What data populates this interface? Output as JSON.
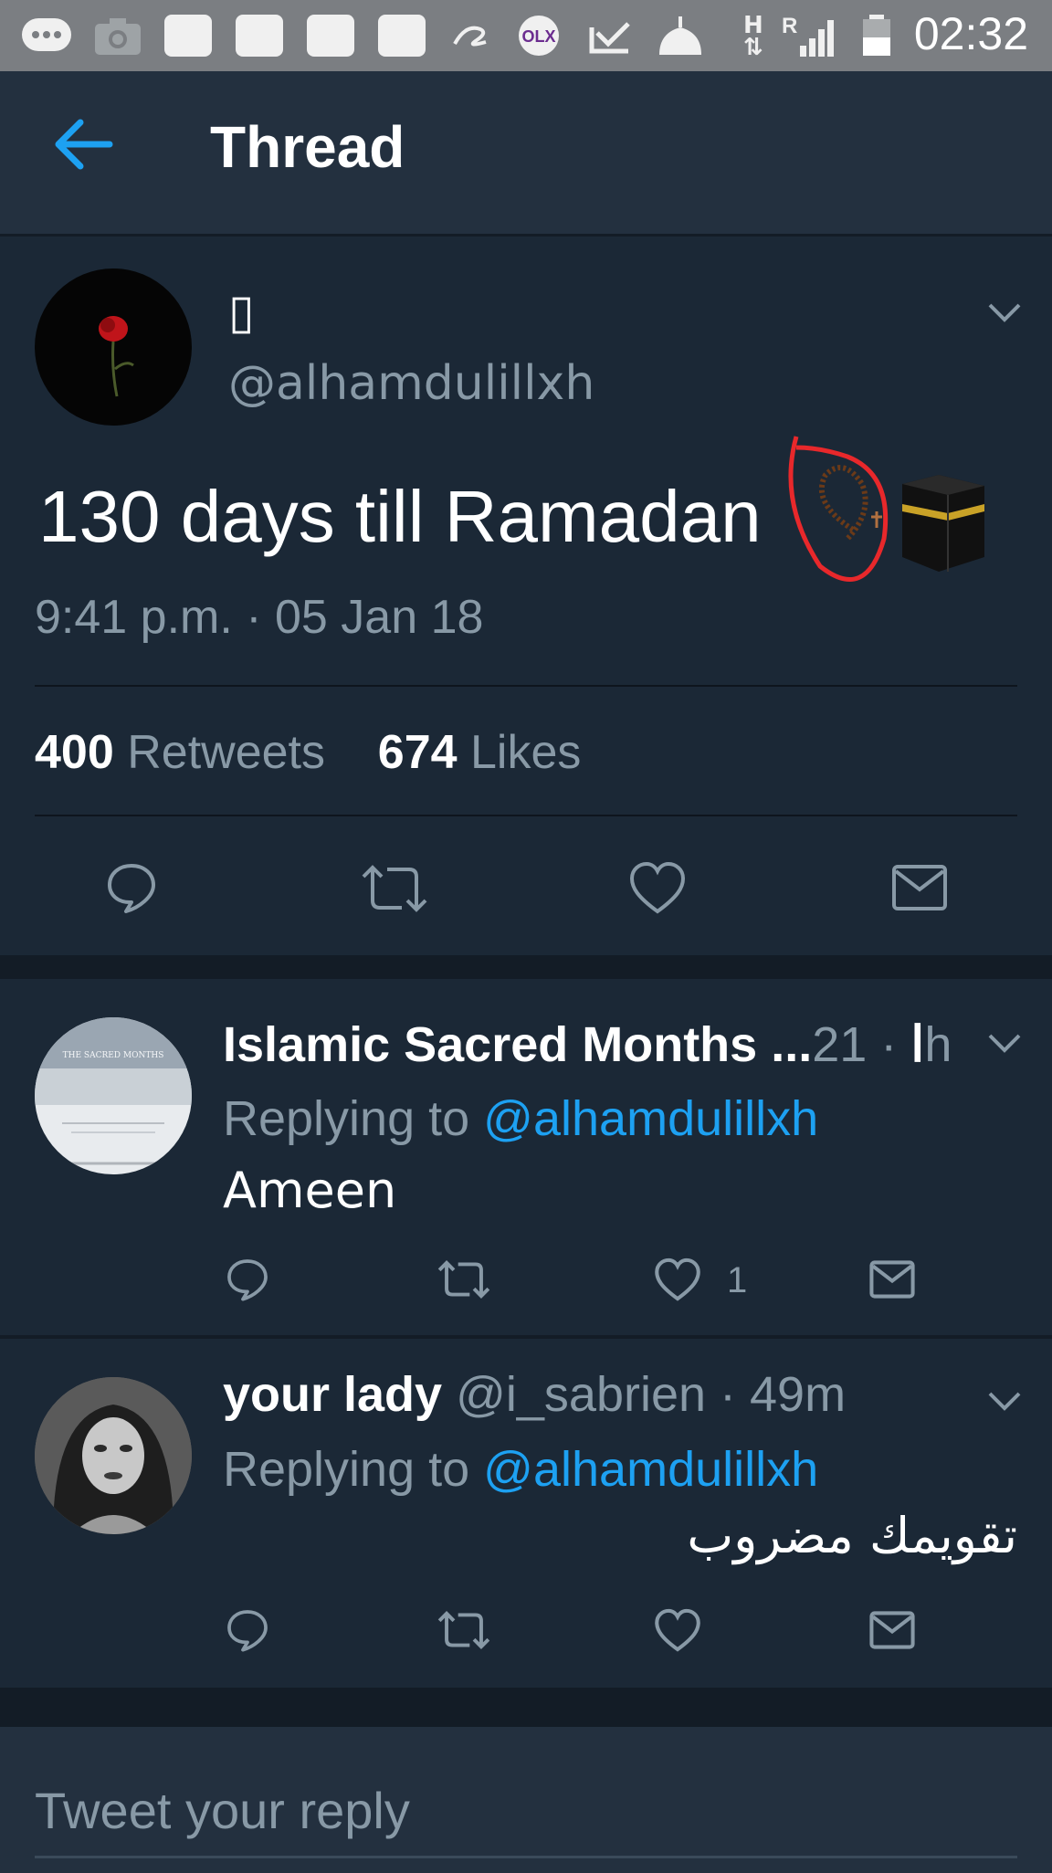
{
  "status_bar": {
    "time": "02:32",
    "network_labels": [
      "H",
      "R"
    ],
    "app_badge": "OLX",
    "icons": [
      "messages-icon",
      "camera-icon",
      "app-icon",
      "app-icon",
      "app-icon",
      "app-icon",
      "alibaba-icon",
      "olx-icon",
      "check-icon",
      "mosque-icon",
      "signal-icon",
      "battery-icon"
    ]
  },
  "app_bar": {
    "title": "Thread",
    "back_icon": "back-arrow-icon"
  },
  "main_tweet": {
    "display_name": "▯",
    "handle": "@alhamdulillxh",
    "text": "130 days till Ramadan",
    "emojis": [
      "prayer-beads-icon",
      "kaaba-icon"
    ],
    "timestamp": "9:41 p.m. · 05 Jan 18",
    "retweet_count": "400",
    "retweet_label": "Retweets",
    "like_count": "674",
    "like_label": "Likes"
  },
  "replies": [
    {
      "name": "Islamic Sacred Months ...ا",
      "meta": " · 21h",
      "replying_prefix": "Replying to ",
      "replying_to": "@alhamdulillxh",
      "text": "Ameen",
      "like_count": "1",
      "avatar_caption": "THE SACRED MONTHS"
    },
    {
      "name": "your lady",
      "meta": " @i_sabrien · 49m",
      "replying_prefix": "Replying to ",
      "replying_to": "@alhamdulillxh",
      "text": "تقويمك مضروب",
      "like_count": ""
    }
  ],
  "composer": {
    "placeholder": "Tweet your reply"
  },
  "colors": {
    "background": "#1b2836",
    "bar": "#23303f",
    "accent": "#1da1f2",
    "muted": "#8899a6",
    "annotation": "#e8282b"
  }
}
